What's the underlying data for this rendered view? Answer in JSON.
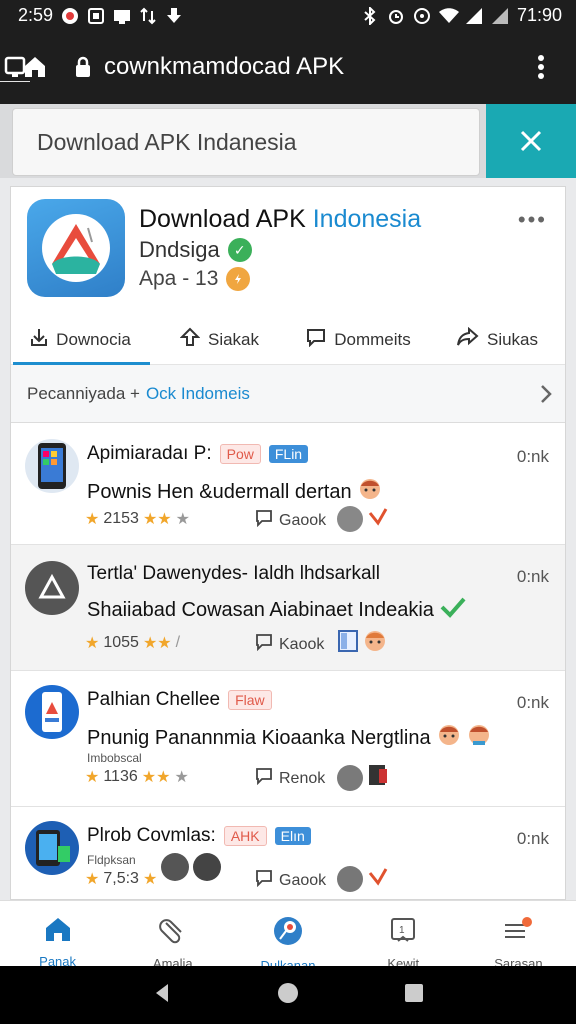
{
  "status_bar": {
    "time": "2:59",
    "right_time": "71:90",
    "icons_left": [
      "notification-icon",
      "app-icon",
      "message-icon",
      "data-icon",
      "download-icon"
    ],
    "icons_right": [
      "bluetooth-icon",
      "alarm-icon",
      "vibrate-icon",
      "wifi-icon",
      "signal-icon",
      "battery-icon"
    ]
  },
  "url_bar": {
    "url": "cownkmamdocad APK",
    "icons": [
      "home-icon",
      "lock-icon",
      "tabs-icon",
      "menu-icon"
    ]
  },
  "search": {
    "value": "Download APK Indanesia",
    "close_icon": "close-icon"
  },
  "app": {
    "title_main": "Download APK ",
    "title_accent": "Indonesia",
    "developer": "Dndsiga",
    "version": "Apa - 13",
    "accent_color": "#1a8ad0",
    "verified_color": "#3bb05a",
    "badge_color": "#f0a640"
  },
  "tabs": [
    {
      "label": "Downocia",
      "icon": "download-icon",
      "active": true
    },
    {
      "label": "Siakak",
      "icon": "upload-icon",
      "active": false
    },
    {
      "label": "Dommeits",
      "icon": "comment-icon",
      "active": false
    },
    {
      "label": "Siukas",
      "icon": "share-icon",
      "active": false
    }
  ],
  "breadcrumb": {
    "text": "Pecanniyada +",
    "link": "Ock Indomeis"
  },
  "items": [
    {
      "title": "Apimiaradaı P:",
      "tags": [
        {
          "label": "Pow",
          "style": "red"
        },
        {
          "label": "FLin",
          "style": "blue"
        }
      ],
      "time": "0:nk",
      "desc": "Pownis Hen &udermall dertan",
      "sub": "",
      "rating": "2153",
      "comment": "Gaook"
    },
    {
      "title": "Tertla' Dawenydes- Ialdh lhdsarkall",
      "tags": [],
      "time": "0:nk",
      "desc": "Shaiiabad Cowasan Aiabinaet Indeakia",
      "sub": "",
      "rating": "1055",
      "comment": "Kaook"
    },
    {
      "title": "Palhian Chellee",
      "tags": [
        {
          "label": "Flaw",
          "style": "red"
        }
      ],
      "time": "0:nk",
      "desc": "Pnunig Panannmia Kioaanka Nergtlina",
      "sub": "Imbobscal",
      "rating": "1136",
      "comment": "Renok"
    },
    {
      "title": "Plrob Covmlas:",
      "tags": [
        {
          "label": "AHK",
          "style": "red"
        },
        {
          "label": "Elın",
          "style": "blue"
        }
      ],
      "time": "0:nk",
      "desc": "",
      "sub": "Fldpksan",
      "rating": "7,5:3",
      "comment": "Gaook"
    }
  ],
  "bottom_nav": [
    {
      "label": "Panak",
      "icon": "home-icon",
      "active": true
    },
    {
      "label": "Amalia",
      "icon": "clip-icon",
      "active": false
    },
    {
      "label": "Dulkanan",
      "icon": "pin-icon",
      "active": true
    },
    {
      "label": "Kewit",
      "icon": "calendar-icon",
      "active": false
    },
    {
      "label": "Sarasan",
      "icon": "list-icon",
      "active": false
    }
  ]
}
